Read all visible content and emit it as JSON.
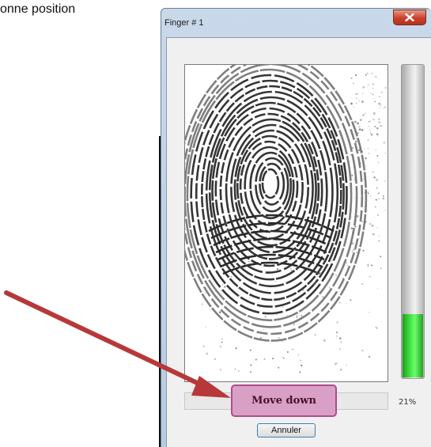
{
  "background_caption": "onne position",
  "window": {
    "title": "Finger # 1",
    "close_icon": "close-x-icon",
    "close_color": "#c9402a"
  },
  "scan": {
    "image": "fingerprint-image",
    "description_icon": "fingerprint"
  },
  "quality_meter": {
    "level": 0.21,
    "fill_color": "#3fe03f"
  },
  "progress": {
    "percent_label": "21%"
  },
  "buttons": {
    "cancel_label": "Annuler"
  },
  "annotation": {
    "callout_label": "Move down",
    "callout_color": "#d9a0c6",
    "arrow_color": "#b8383a"
  }
}
